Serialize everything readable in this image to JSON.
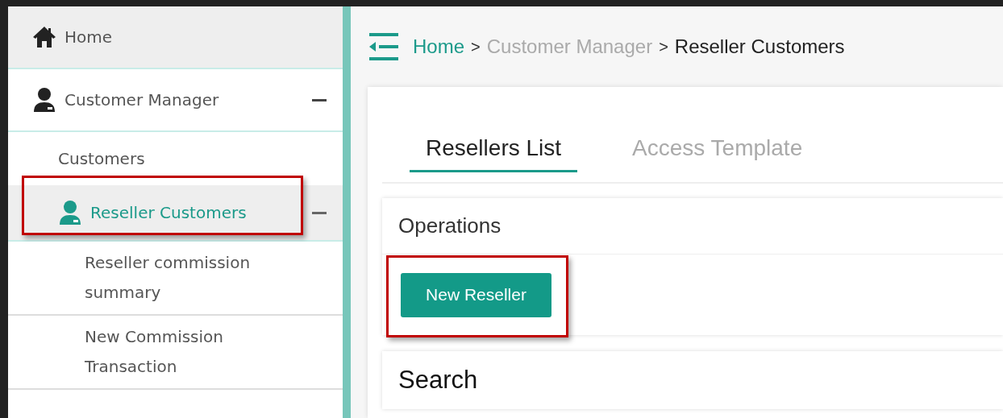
{
  "sidebar": {
    "items": [
      {
        "label": "Home",
        "selected": false
      },
      {
        "label": "Customer Manager",
        "selected": false,
        "expanded": true,
        "children": [
          {
            "label": "Customers",
            "selected": false
          },
          {
            "label": "Reseller Customers",
            "selected": true,
            "expanded": true,
            "highlighted": true,
            "children": [
              {
                "label": "Reseller commission summary",
                "selected": false
              },
              {
                "label": "New Commission Transaction",
                "selected": false
              }
            ]
          }
        ]
      }
    ]
  },
  "breadcrumb": [
    {
      "label": "Home",
      "kind": "link"
    },
    {
      "separator": ">",
      "label": "Customer Manager",
      "kind": "inactive"
    },
    {
      "separator": ">",
      "label": "Reseller Customers",
      "kind": "current"
    }
  ],
  "tabs": [
    {
      "label": "Resellers List",
      "selected": true
    },
    {
      "label": "Access Template",
      "selected": false
    }
  ],
  "operations": {
    "title": "Operations",
    "button": {
      "label": "New Reseller",
      "highlighted": true
    }
  },
  "search": {
    "title": "Search"
  }
}
